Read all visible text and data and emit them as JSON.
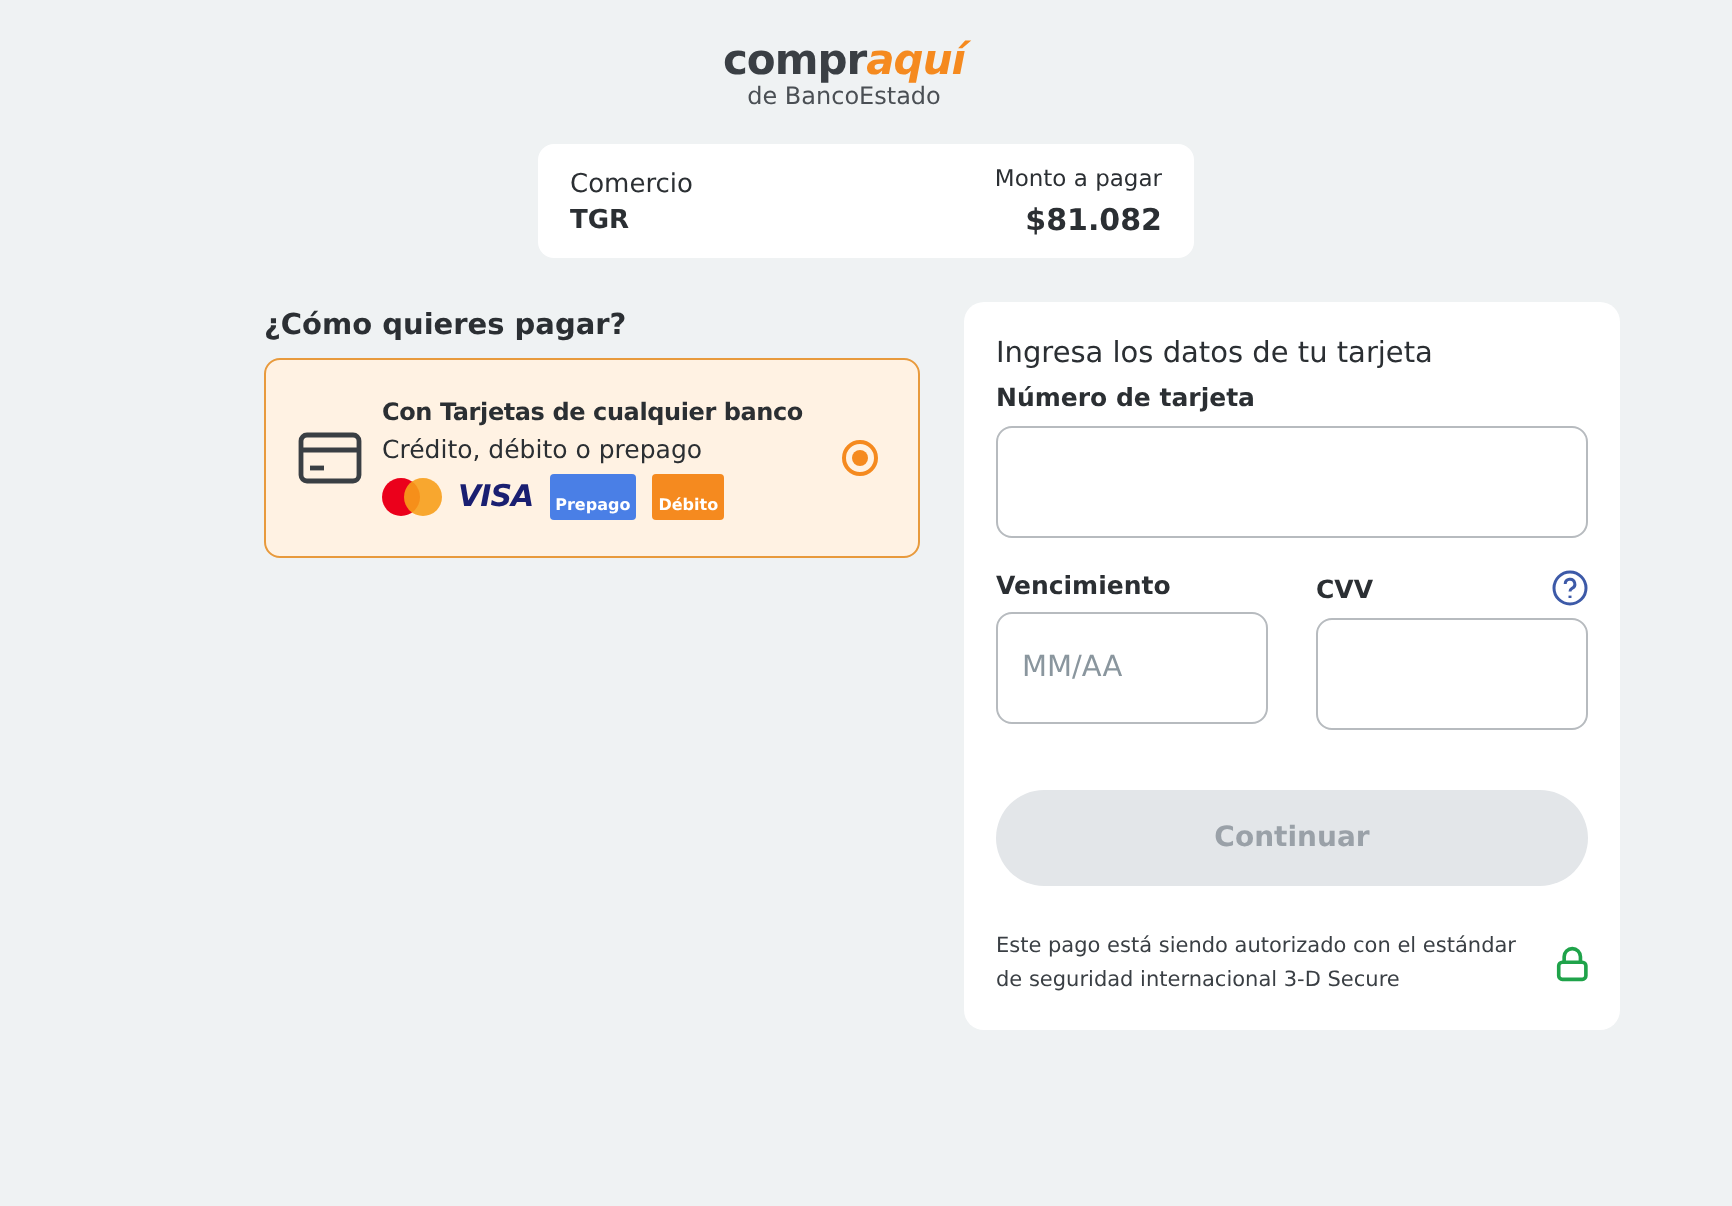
{
  "logo": {
    "word_start": "compr",
    "word_end": "aquí",
    "subtitle": "de BancoEstado"
  },
  "summary": {
    "merchant_label": "Comercio",
    "merchant": "TGR",
    "amount_label": "Monto a pagar",
    "amount": "$81.082"
  },
  "payment_question": "¿Cómo quieres pagar?",
  "payment_options": [
    {
      "title": "Con Tarjetas de cualquier banco",
      "subtitle": "Crédito, débito o prepago",
      "selected": true,
      "brands": [
        {
          "kind": "mastercard"
        },
        {
          "kind": "visa",
          "label": "VISA"
        },
        {
          "kind": "badge",
          "label": "Prepago",
          "color": "#4a7fe6"
        },
        {
          "kind": "badge",
          "label": "Débito",
          "color": "#f58a1f"
        }
      ]
    }
  ],
  "card_form": {
    "heading": "Ingresa los datos de tu tarjeta",
    "number_label": "Número de tarjeta",
    "expiry_label": "Vencimiento",
    "expiry_placeholder": "MM/AA",
    "cvv_label": "CVV",
    "submit": {
      "label": "Continuar",
      "disabled": true
    },
    "security_note": "Este pago está siendo autorizado con el estándar de seguridad internacional 3-D Secure"
  }
}
